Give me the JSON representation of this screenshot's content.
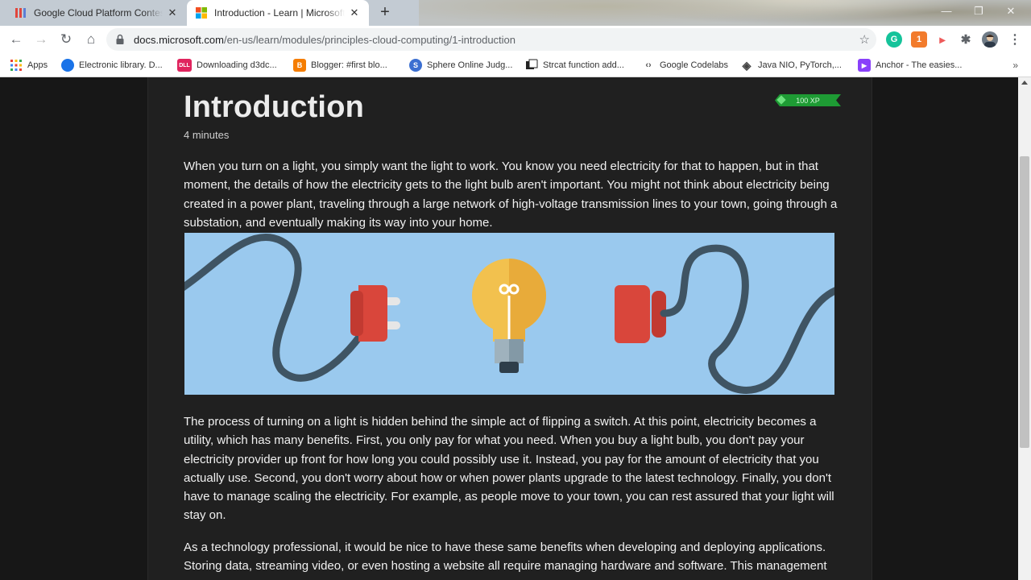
{
  "tabs": [
    {
      "title": "Google Cloud Platform Contests",
      "close": "✕",
      "active": false
    },
    {
      "title": "Introduction - Learn | Microsoft Docs",
      "close": "✕",
      "active": true
    }
  ],
  "new_tab": "+",
  "window_controls": {
    "minimize": "—",
    "restore": "❐",
    "close": "✕"
  },
  "toolbar": {
    "back": "←",
    "forward": "→",
    "reload": "↻",
    "home": "⌂",
    "url_host": "docs.microsoft.com",
    "url_path": "/en-us/learn/modules/principles-cloud-computing/1-introduction",
    "bookmark_star": "☆",
    "extensions": [
      {
        "icon": "grammarly-icon",
        "label": "G",
        "color": "#15c39a"
      },
      {
        "icon": "extension-badge-icon",
        "label": "1",
        "color": "#f27b2c"
      },
      {
        "icon": "screencast-icon",
        "label": "▸",
        "color": "#ee5a5a"
      },
      {
        "icon": "puzzle-icon",
        "label": "✱",
        "color": "#5f6368"
      }
    ],
    "menu": "⋮"
  },
  "bookmarks": [
    {
      "label": "Apps",
      "icon": "apps-grid-icon"
    },
    {
      "label": "Electronic library. D...",
      "icon": "library-icon",
      "color": "#1a73e8"
    },
    {
      "label": "Downloading d3dc...",
      "icon": "dll-icon",
      "badge": "DLL",
      "color": "#e0245e"
    },
    {
      "label": "Blogger: #first blo...",
      "icon": "blogger-icon",
      "badge": "B",
      "color": "#f57d00"
    },
    {
      "label": "Sphere Online Judg...",
      "icon": "spoj-icon",
      "badge": "S",
      "color": "#3b6fd1"
    },
    {
      "label": "Strcat function add...",
      "icon": "bookmark-page-icon",
      "color": "#222222"
    },
    {
      "label": "Google Codelabs",
      "icon": "codelabs-icon",
      "badge": "‹›",
      "color": "#555555"
    },
    {
      "label": "Java NIO, PyTorch,...",
      "icon": "diamond-icon",
      "badge": "◈",
      "color": "#444444"
    },
    {
      "label": "Anchor - The easies...",
      "icon": "anchor-icon",
      "badge": "▶",
      "color": "#8940fa"
    }
  ],
  "bookmarks_more": "»",
  "article": {
    "title": "Introduction",
    "duration": "4 minutes",
    "xp": "100 XP",
    "paragraphs": [
      "When you turn on a light, you simply want the light to work. You know you need electricity for that to happen, but in that moment, the details of how the electricity gets to the light bulb aren't important. You might not think about electricity being created in a power plant, traveling through a large network of high-voltage transmission lines to your town, going through a substation, and eventually making its way into your home.",
      "The process of turning on a light is hidden behind the simple act of flipping a switch. At this point, electricity becomes a utility, which has many benefits. First, you only pay for what you need. When you buy a light bulb, you don't pay your electricity provider up front for how long you could possibly use it. Instead, you pay for the amount of electricity that you actually use. Second, you don't worry about how or when power plants upgrade to the latest technology. Finally, you don't have to manage scaling the electricity. For example, as people move to your town, you can rest assured that your light will stay on.",
      "As a technology professional, it would be nice to have these same benefits when developing and deploying applications. Storing data, streaming video, or even hosting a website all require managing hardware and software. This management is"
    ]
  },
  "colors": {
    "page_bg": "#171717",
    "content_bg": "#202020",
    "xp_green": "#1e9b34",
    "illustration_sky": "#9ac9ee",
    "plug_red": "#d9463b",
    "bulb_yellow": "#f2c14e"
  }
}
